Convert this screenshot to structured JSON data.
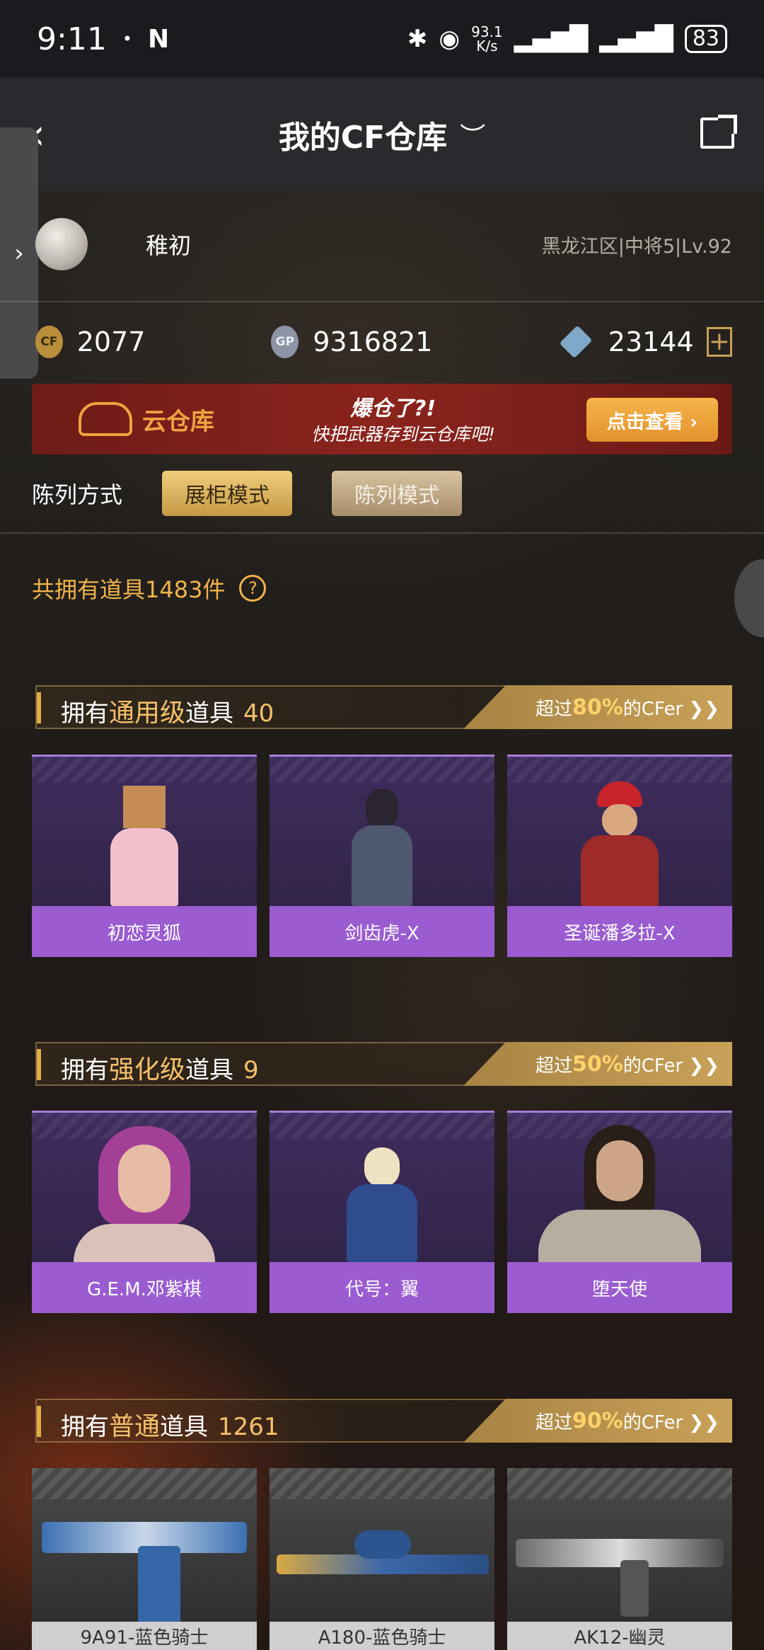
{
  "status": {
    "time": "9:11",
    "dot": "•",
    "nfc": "N",
    "speed_top": "93.1",
    "speed_bottom": "K/s",
    "battery": "83"
  },
  "nav": {
    "title": "我的CF仓库",
    "back_glyph": "‹",
    "eye_glyph": "︶",
    "side_arrow": "›"
  },
  "profile": {
    "name": "稚初",
    "level": "黑龙江区|中将5|Lv.92"
  },
  "currency": {
    "cf_icon_text": "CF",
    "cf": "2077",
    "gp_icon_text": "GP",
    "gp": "9316821",
    "diamond": "23144",
    "plus": "+"
  },
  "banner": {
    "label": "云仓库",
    "slogan1": "爆仓了?!",
    "slogan2": "快把武器存到云仓库吧!",
    "button": "点击查看 ›"
  },
  "display": {
    "label": "陈列方式",
    "mode_cabinet": "展柜模式",
    "mode_list": "陈列模式"
  },
  "total": {
    "text": "共拥有道具1483件",
    "help": "?"
  },
  "sections": [
    {
      "prefix": "拥有",
      "grade": "通用级",
      "suffix": "道具",
      "count": "40",
      "tag_pre": "超过",
      "tag_pct": "80%",
      "tag_post": "的CFer ❯❯",
      "items": [
        "初恋灵狐",
        "剑齿虎-X",
        "圣诞潘多拉-X"
      ]
    },
    {
      "prefix": "拥有",
      "grade": "强化级",
      "suffix": "道具",
      "count": "9",
      "tag_pre": "超过",
      "tag_pct": "50%",
      "tag_post": "的CFer ❯❯",
      "items": [
        "G.E.M.邓紫棋",
        "代号：翼",
        "堕天使"
      ]
    },
    {
      "prefix": "拥有",
      "grade": "普通",
      "suffix": "道具",
      "count": "1261",
      "tag_pre": "超过",
      "tag_pct": "90%",
      "tag_post": "的CFer ❯❯",
      "items": [
        "9A91-蓝色骑士",
        "A180-蓝色骑士",
        "AK12-幽灵"
      ]
    }
  ]
}
